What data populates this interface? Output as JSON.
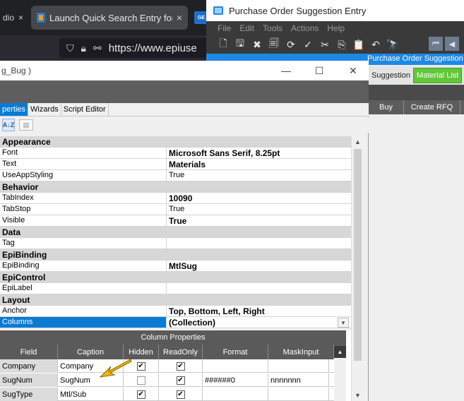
{
  "browser": {
    "left_tab_fragment": "dio",
    "left_tab_close": "×",
    "active_tab_title": "Launch Quick Search Entry for a",
    "active_tab_close": "×",
    "third_tab_icon": "GE",
    "url": "https://www.epiuse",
    "shield_icon": "shield-icon",
    "lock_icon": "lock-icon"
  },
  "po_window": {
    "title": "Purchase Order Suggestion Entry",
    "menu": [
      "File",
      "Edit",
      "Tools",
      "Actions",
      "Help"
    ],
    "toolbar_icons": [
      "new-icon",
      "save-icon",
      "delete-icon",
      "attach-icon",
      "refresh-icon",
      "check-icon",
      "cut-icon",
      "copy-icon",
      "paste-icon",
      "undo-icon",
      "search-icon"
    ],
    "toolbar_glyphs": [
      "🗋",
      "🖫",
      "✖",
      "🗐",
      "⟳",
      "✓",
      "✂",
      "⎘",
      "📋",
      "↶",
      "🔭"
    ],
    "nav_glyphs": [
      "⏮",
      "◀"
    ],
    "bluebar_text": "Purchase Order Suggestion",
    "tabs": [
      "Suggestion",
      "Material List"
    ],
    "active_tab": "Material List",
    "columns": [
      "Buy",
      "Create RFQ"
    ]
  },
  "dialog": {
    "title_fragment": "g_Bug )",
    "minimize": "—",
    "maximize": "☐",
    "close": "✕",
    "tabs": [
      "perties",
      "Wizards",
      "Script Editor"
    ],
    "active_tab": "perties",
    "sort_label": "A↓Z"
  },
  "property_grid": {
    "rows": [
      {
        "name": "Appearance",
        "value": "",
        "category": true
      },
      {
        "name": "Font",
        "value": "Microsoft Sans Serif, 8.25pt",
        "bold": true
      },
      {
        "name": "Text",
        "value": "Materials",
        "bold": true
      },
      {
        "name": "UseAppStyling",
        "value": "True",
        "bold": false
      },
      {
        "name": "Behavior",
        "value": "",
        "category": true
      },
      {
        "name": "TabIndex",
        "value": "10090",
        "bold": true
      },
      {
        "name": "TabStop",
        "value": "True",
        "bold": false
      },
      {
        "name": "Visible",
        "value": "True",
        "bold": true
      },
      {
        "name": "Data",
        "value": "",
        "category": true
      },
      {
        "name": "Tag",
        "value": "",
        "bold": false
      },
      {
        "name": "EpiBinding",
        "value": "",
        "category": true
      },
      {
        "name": "EpiBinding",
        "value": "MtlSug",
        "bold": true
      },
      {
        "name": "EpiControl",
        "value": "",
        "category": true
      },
      {
        "name": "EpiLabel",
        "value": "",
        "bold": false
      },
      {
        "name": "Layout",
        "value": "",
        "category": true
      },
      {
        "name": "Anchor",
        "value": "Top, Bottom, Left, Right",
        "bold": true
      },
      {
        "name": "Columns",
        "value": "(Collection)",
        "bold": true,
        "selected": true
      }
    ]
  },
  "column_properties": {
    "caption": "Column Properties",
    "headers": [
      "Field",
      "Caption",
      "Hidden",
      "ReadOnly",
      "Format",
      "MaskInput"
    ],
    "rows": [
      {
        "field": "Company",
        "caption": "Company",
        "hidden": true,
        "readonly": true,
        "format": "",
        "mask": ""
      },
      {
        "field": "SugNum",
        "caption": "SugNum",
        "hidden": false,
        "readonly": true,
        "format": "######0",
        "mask": "nnnnnnn"
      },
      {
        "field": "SugType",
        "caption": "Mtl/Sub",
        "hidden": true,
        "readonly": true,
        "format": "",
        "mask": ""
      }
    ]
  }
}
